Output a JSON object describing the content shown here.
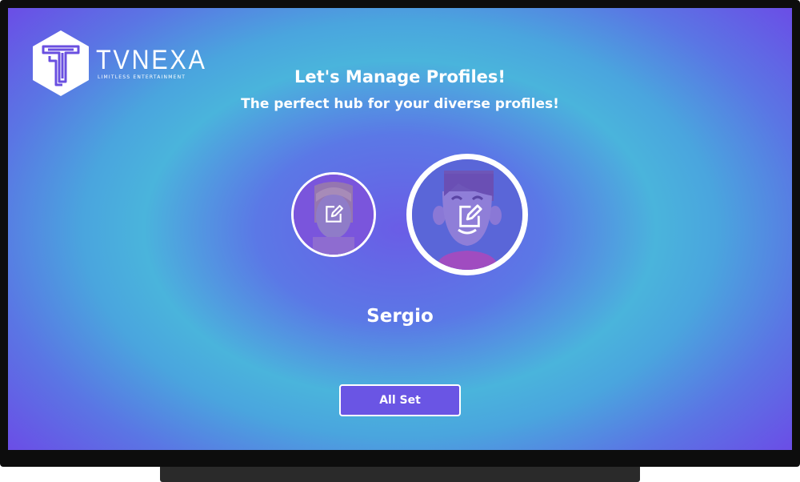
{
  "brand": {
    "name": "TVNEXA",
    "tagline": "LIMITLESS ENTERTAINMENT"
  },
  "header": {
    "title": "Let's Manage Profiles!",
    "subtitle": "The perfect hub for your diverse profiles!"
  },
  "profiles": [
    {
      "avatar": "female-avatar",
      "selected": false,
      "icon": "edit-icon"
    },
    {
      "avatar": "male-avatar",
      "selected": true,
      "icon": "edit-icon"
    }
  ],
  "selected_profile": {
    "name": "Sergio"
  },
  "actions": {
    "all_set_label": "All Set"
  },
  "colors": {
    "accent": "#6a55e4",
    "background_center": "#4ab4dc",
    "background_edge": "#6a4fe6"
  }
}
